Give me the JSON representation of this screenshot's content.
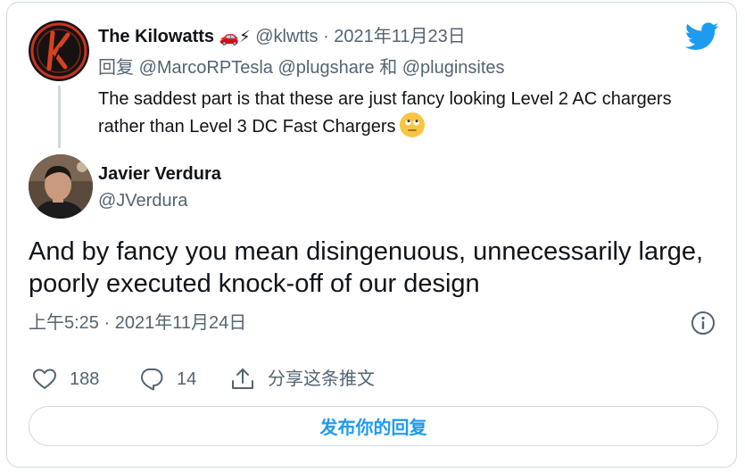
{
  "parent_tweet": {
    "display_name": "The Kilowatts",
    "name_emojis": "🚗⚡",
    "handle": "@klwtts",
    "separator": " · ",
    "date": "2021年11月23日",
    "reply_prefix": "回复",
    "reply_mentions": [
      "@MarcoRPTesla",
      "@plugshare",
      "@pluginsites"
    ],
    "reply_joiner": "和",
    "text": "The saddest part is that these are just fancy looking Level 2 AC chargers rather than Level 3 DC Fast Chargers",
    "text_emoji": "face-with-rolling-eyes"
  },
  "tweet": {
    "display_name": "Javier Verdura",
    "handle": "@JVerdura",
    "text": "And by fancy you mean disingenuous, unnecessarily large, poorly executed knock-off of our design",
    "timestamp": "上午5:25 · 2021年11月24日"
  },
  "actions": {
    "likes": "188",
    "replies": "14",
    "share_label": "分享这条推文"
  },
  "reply_button_label": "发布你的回复",
  "colors": {
    "accent": "#1d9bf0",
    "text": "#0f1419",
    "muted": "#536471",
    "border": "#cfd9de"
  },
  "icons": [
    "twitter-bird-icon",
    "info-icon",
    "heart-icon",
    "reply-bubble-icon",
    "share-icon"
  ]
}
